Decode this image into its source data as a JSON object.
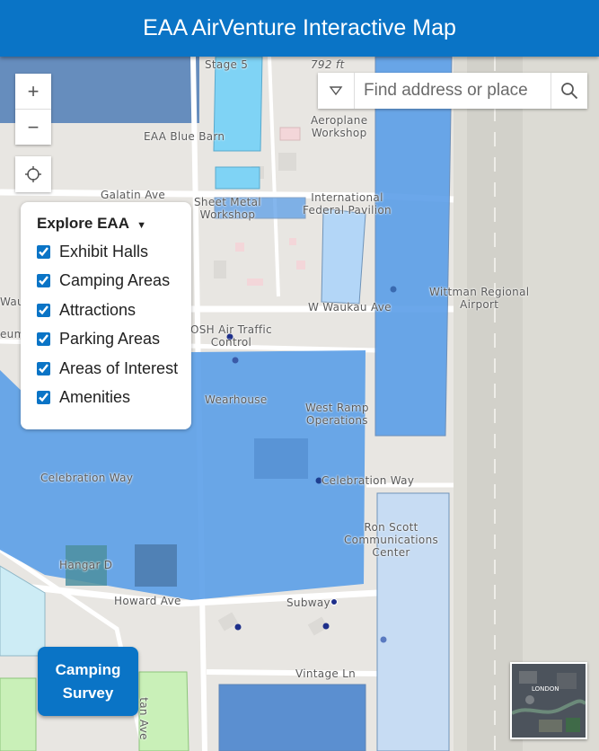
{
  "app": {
    "title": "EAA AirVenture Interactive Map"
  },
  "zoom": {
    "in_label": "+",
    "out_label": "−"
  },
  "search": {
    "placeholder": "Find address or place"
  },
  "layers": {
    "title": "Explore EAA",
    "items": [
      {
        "label": "Exhibit Halls",
        "checked": true
      },
      {
        "label": "Camping Areas",
        "checked": true
      },
      {
        "label": "Attractions",
        "checked": true
      },
      {
        "label": "Parking Areas",
        "checked": true
      },
      {
        "label": "Areas of Interest",
        "checked": true
      },
      {
        "label": "Amenities",
        "checked": true
      }
    ]
  },
  "map": {
    "labels": {
      "stage5": "Stage 5",
      "elevation": "792 ft",
      "blue_barn": "EAA Blue Barn",
      "aeroplane_workshop": "Aeroplane\nWorkshop",
      "galatin_ave": "Galatin Ave",
      "sheet_metal": "Sheet Metal\nWorkshop",
      "intl_pavilion": "International\nFederal Pavilion",
      "wittman": "Wittman Regional\nAirport",
      "w_waukau": "W Waukau Ave",
      "wau": "Wau",
      "eum": "eum",
      "osh_atc": "OSH Air Traffic\nControl",
      "wearhouse": "Wearhouse",
      "west_ramp": "West Ramp\nOperations",
      "celebration_way_w": "Celebration Way",
      "celebration_way_e": "Celebration Way",
      "ron_scott": "Ron Scott\nCommunications\nCenter",
      "hangar_d": "Hangar D",
      "howard_ave": "Howard Ave",
      "subway": "Subway",
      "vintage_ln": "Vintage Ln",
      "vertical_st": "tan Ave"
    }
  },
  "survey": {
    "label": "Camping\nSurvey"
  },
  "overview": {
    "city_label": "LONDON"
  },
  "colors": {
    "header": "#0a74c6",
    "exhibit": "#5b9ee8",
    "camping": "#c9f0b8",
    "attraction": "#7fd3f5"
  }
}
